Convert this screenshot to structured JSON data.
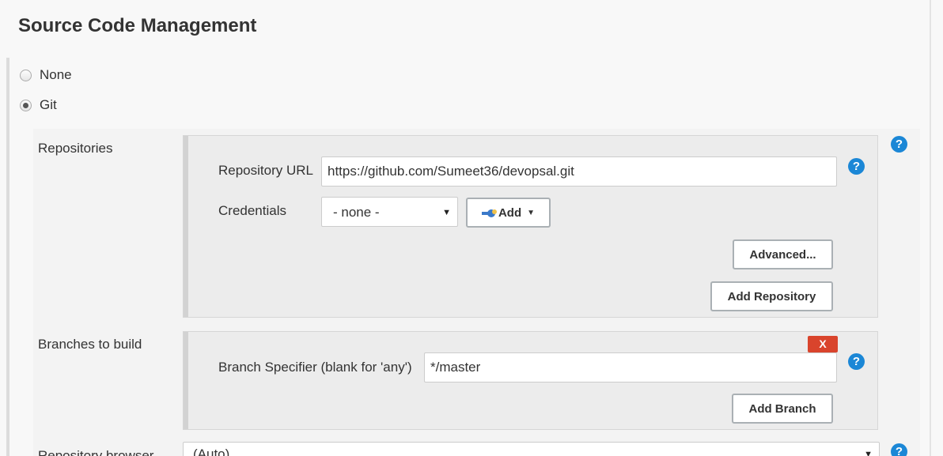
{
  "section": {
    "title": "Source Code Management"
  },
  "scm_options": [
    {
      "label": "None",
      "selected": false
    },
    {
      "label": "Git",
      "selected": true
    }
  ],
  "repositories": {
    "label": "Repositories",
    "url_label": "Repository URL",
    "url_value": "https://github.com/Sumeet36/devopsal.git",
    "credentials_label": "Credentials",
    "credentials_value": "- none -",
    "add_label": "Add",
    "advanced_label": "Advanced...",
    "add_repository_label": "Add Repository"
  },
  "branches": {
    "label": "Branches to build",
    "delete_label": "X",
    "specifier_label": "Branch Specifier (blank for 'any')",
    "specifier_value": "*/master",
    "add_branch_label": "Add Branch"
  },
  "repository_browser": {
    "label": "Repository browser",
    "value": "(Auto)"
  },
  "help_icon": "?",
  "colors": {
    "help": "#1b87d6",
    "delete": "#d9442c",
    "group_bg": "#ececec"
  }
}
